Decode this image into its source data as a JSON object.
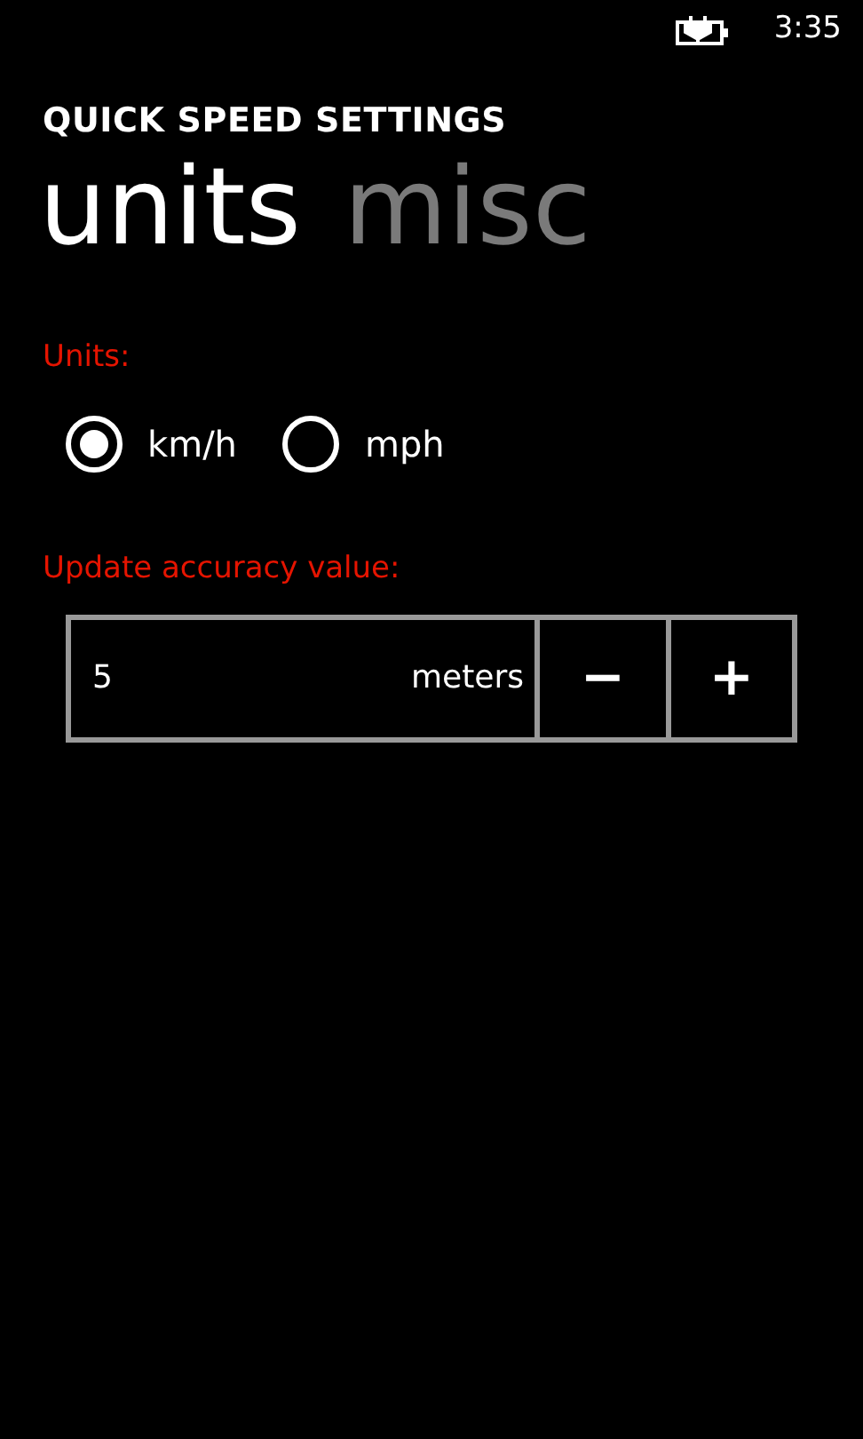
{
  "status_bar": {
    "time": "3:35"
  },
  "app_title": "QUICK SPEED SETTINGS",
  "pivot": [
    {
      "label": "units",
      "selected": true
    },
    {
      "label": "misc",
      "selected": false
    }
  ],
  "units": {
    "label": "Units:",
    "options": [
      {
        "label": "km/h",
        "selected": true
      },
      {
        "label": "mph",
        "selected": false
      }
    ]
  },
  "accuracy": {
    "label": "Update accuracy value:",
    "value": "5",
    "unit": "meters",
    "buttons": [
      "−",
      "+"
    ]
  }
}
